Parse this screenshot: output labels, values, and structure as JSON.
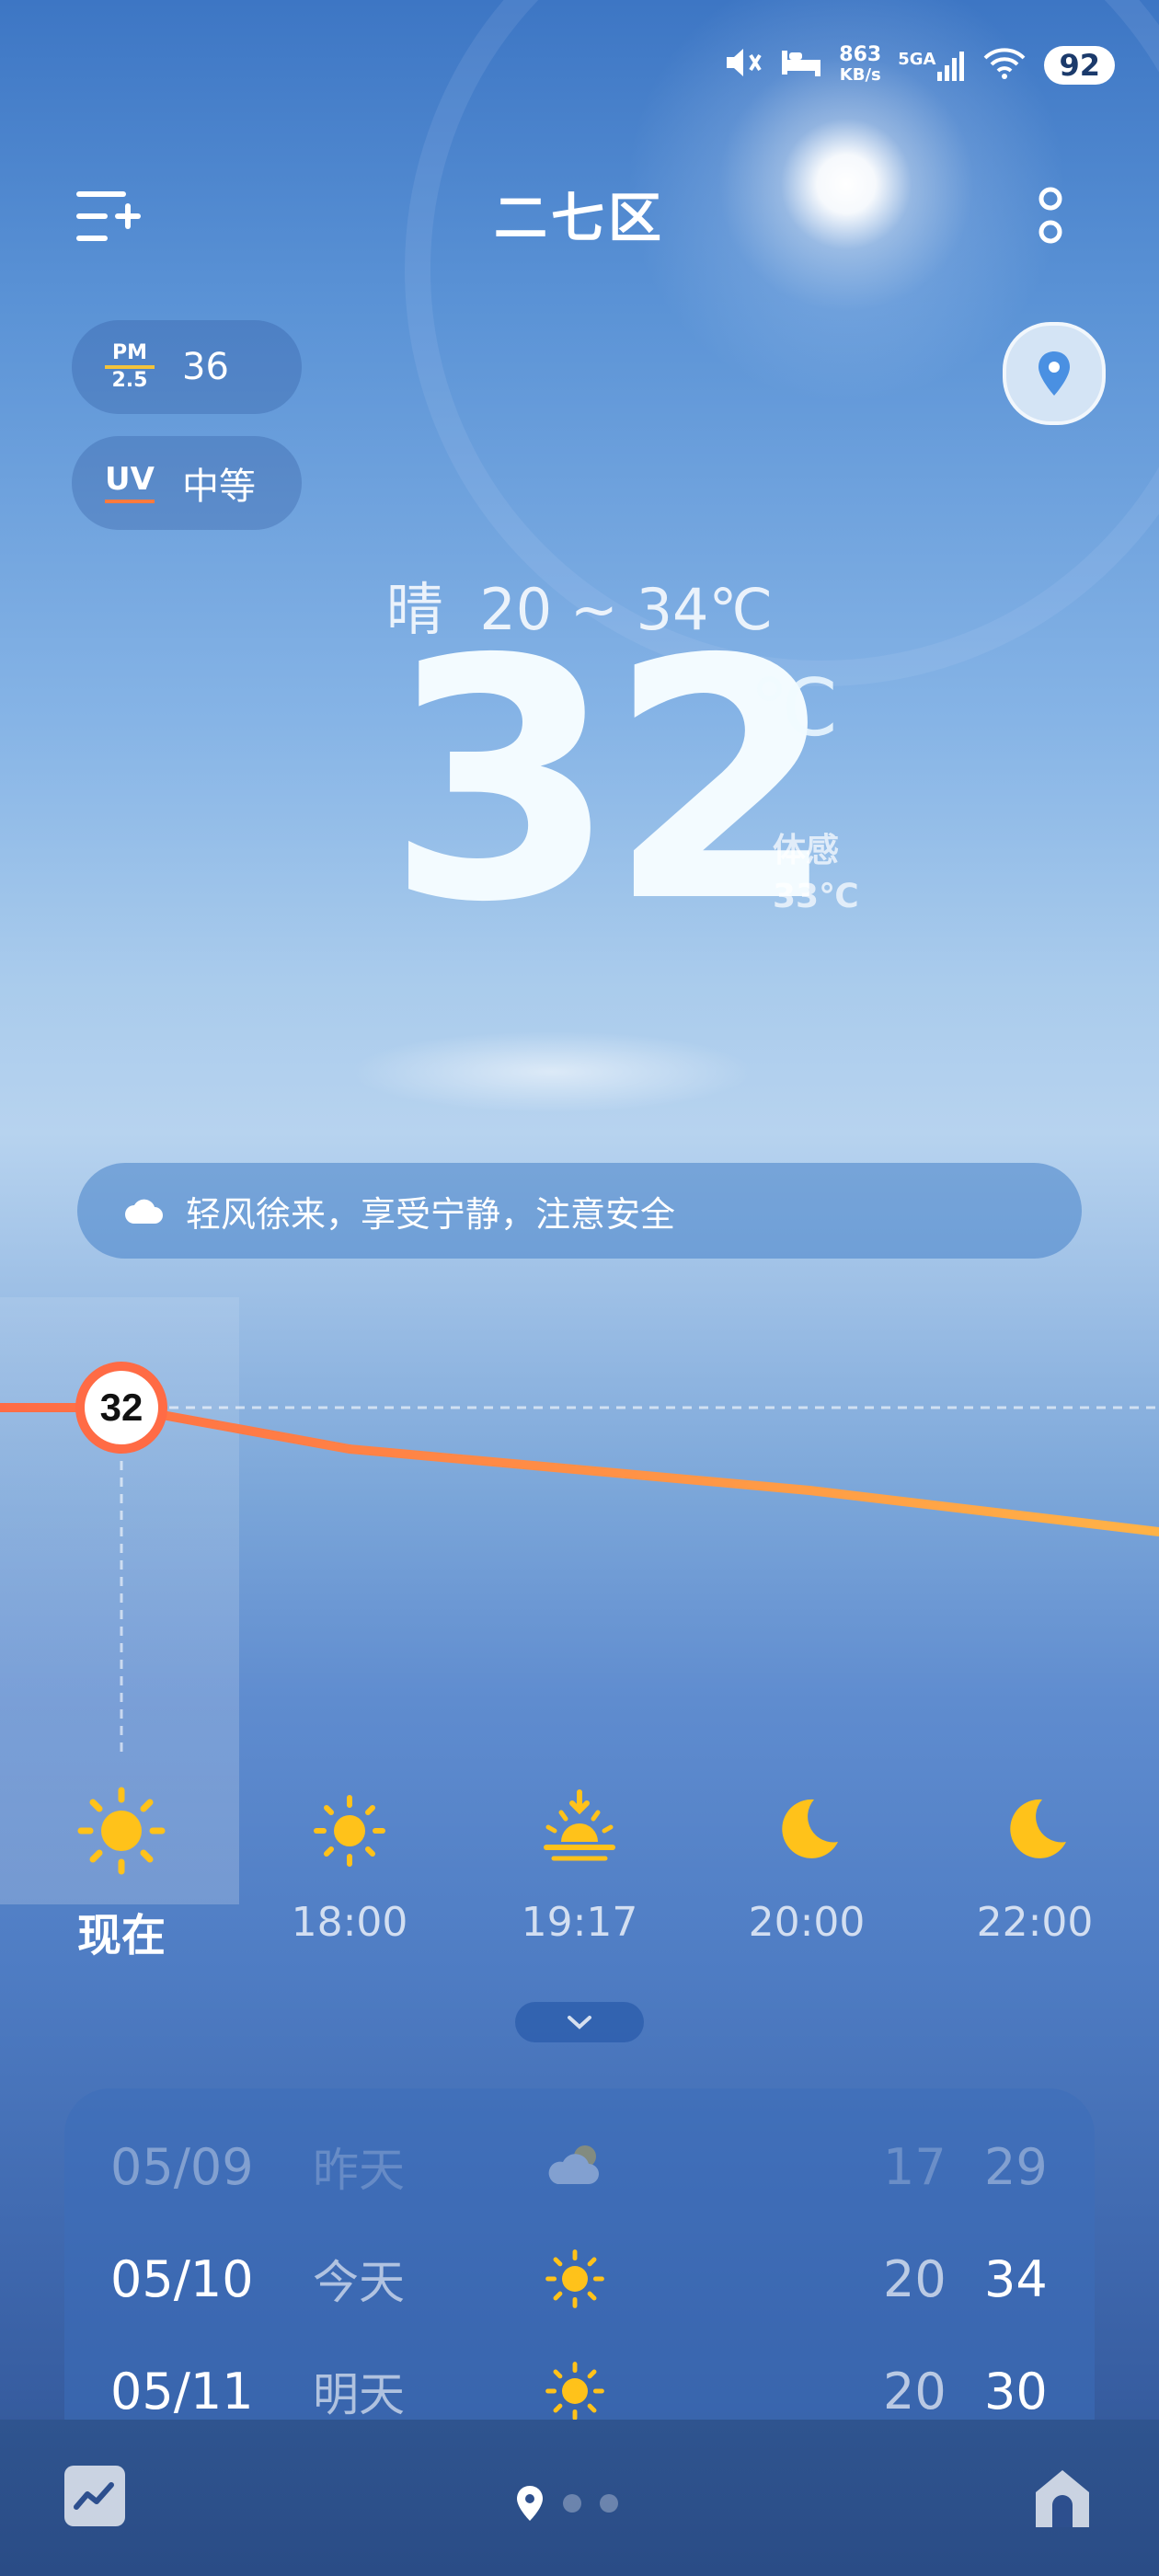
{
  "status_bar": {
    "net_speed_value": "863",
    "net_speed_unit": "KB/s",
    "network_label": "5GA",
    "battery": "92"
  },
  "header": {
    "city": "二七区"
  },
  "air": {
    "pm_top": "PM",
    "pm_bottom": "2.5",
    "pm_value": "36",
    "uv_label": "UV",
    "uv_value": "中等"
  },
  "current": {
    "condition": "晴",
    "range": "20 ~ 34℃",
    "temp": "32",
    "unit": "℃",
    "feels_label": "体感",
    "feels_value": "33℃"
  },
  "tip": "轻风徐来，享受宁静，注意安全",
  "chart_data": {
    "type": "line",
    "series": [
      {
        "values": [
          32,
          31,
          30.5,
          30,
          29
        ]
      }
    ],
    "marker_label": "32"
  },
  "hourly": [
    {
      "label": "现在",
      "icon": "sun-icon"
    },
    {
      "label": "18:00",
      "icon": "sun-icon"
    },
    {
      "label": "19:17",
      "icon": "sunset-icon"
    },
    {
      "label": "20:00",
      "icon": "moon-icon"
    },
    {
      "label": "22:00",
      "icon": "moon-icon"
    }
  ],
  "daily": [
    {
      "date": "05/09",
      "day": "昨天",
      "icon": "cloudy-icon",
      "low": "17",
      "high": "29"
    },
    {
      "date": "05/10",
      "day": "今天",
      "icon": "sun-icon",
      "low": "20",
      "high": "34"
    },
    {
      "date": "05/11",
      "day": "明天",
      "icon": "sun-icon",
      "low": "20",
      "high": "30"
    }
  ],
  "colors": {
    "sun": "#ffc21a",
    "curve": "#ff7a45",
    "curve_end": "#ffb347"
  }
}
